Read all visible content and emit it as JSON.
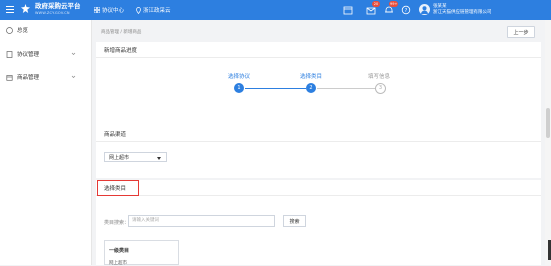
{
  "header": {
    "brand_title": "政府采购云平台",
    "brand_sub": "WWW.ZCY.GOV.CN",
    "nav": [
      {
        "label": "协议中心",
        "icon": "grid-icon"
      },
      {
        "label": "浙江政采云",
        "icon": "location-pin-icon"
      }
    ],
    "icons": [
      "calendar-icon",
      "mail-icon",
      "bell-icon",
      "help-icon",
      "lock-icon"
    ],
    "badges": {
      "mail": "20",
      "bell": "99+"
    },
    "user": {
      "name": "张某某",
      "org": "浙江天猫供应链管理有限公司"
    }
  },
  "sidebar": {
    "items": [
      {
        "label": "总览",
        "icon": "overview-icon",
        "expandable": false
      },
      {
        "label": "协议管理",
        "icon": "document-icon",
        "expandable": true
      },
      {
        "label": "商品管理",
        "icon": "box-icon",
        "expandable": true
      }
    ]
  },
  "breadcrumb": {
    "text": "商品管理 / 新增商品"
  },
  "toolbar": {
    "back_label": "上一步"
  },
  "progress": {
    "title": "新增商品进度",
    "steps": [
      {
        "label": "选择协议",
        "num": "1",
        "state": "done"
      },
      {
        "label": "选择类目",
        "num": "2",
        "state": "done"
      },
      {
        "label": "填写信息",
        "num": "3",
        "state": "todo"
      }
    ]
  },
  "channel": {
    "title": "商品渠道",
    "selected": "网上超市"
  },
  "category": {
    "title": "选择类目",
    "search_label": "类目搜索：",
    "search_placeholder": "请输入关键词",
    "search_button": "搜索",
    "level_header": "一级类目",
    "first_item": "网上超市"
  },
  "colors": {
    "accent": "#2d7fe0",
    "highlight": "#e53935",
    "badge": "#e94e3c"
  }
}
